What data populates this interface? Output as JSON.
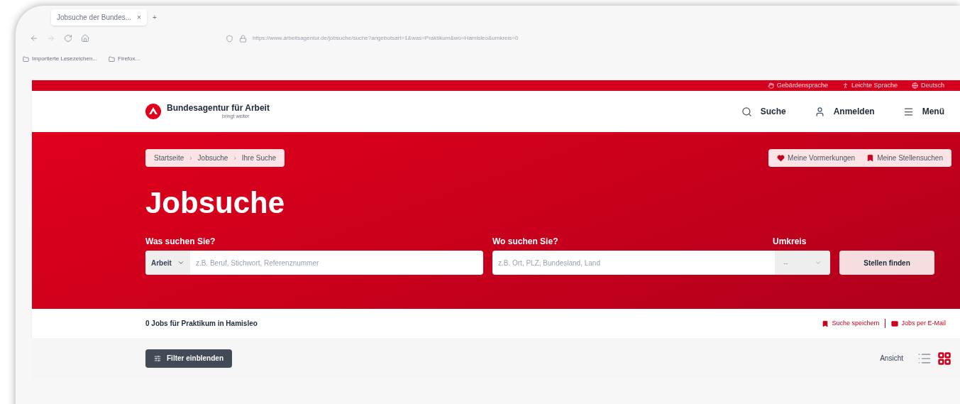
{
  "browser": {
    "tab_title": "Jobsuche der Bundes...",
    "tab_close": "×",
    "new_tab": "+",
    "url": "https://www.arbeitsagentur.de/jobsuche/suche?angebotsart=1&was=Praktikum&wo=Hamisleo&umkreis=0",
    "bookmarks": [
      "Importierte Lesezeichen...",
      "Firefox..."
    ]
  },
  "top_bar": {
    "links": [
      {
        "kind": "hand",
        "label": "Gebärdensprache"
      },
      {
        "kind": "person",
        "label": "Leichte Sprache"
      },
      {
        "kind": "globe",
        "label": "Deutsch"
      }
    ]
  },
  "header": {
    "logo_title": "Bundesagentur für Arbeit",
    "logo_subtitle": "bringt weiter",
    "nav": [
      {
        "kind": "search",
        "label": "Suche"
      },
      {
        "kind": "user",
        "label": "Anmelden"
      },
      {
        "kind": "menu",
        "label": "Menü"
      }
    ]
  },
  "hero": {
    "breadcrumb": [
      "Startseite",
      "Jobsuche",
      "Ihre Suche"
    ],
    "breadcrumb_separator": "›",
    "quick_links": [
      {
        "kind": "heart",
        "label": "Meine Vormerkungen"
      },
      {
        "kind": "bookmark",
        "label": "Meine Stellensuchen"
      }
    ],
    "title": "Jobsuche",
    "what": {
      "label": "Was suchen Sie?",
      "type_value": "Arbeit",
      "placeholder": "z.B. Beruf, Stichwort, Referenznummer"
    },
    "where": {
      "label": "Wo suchen Sie?",
      "placeholder": "z.B. Ort, PLZ, Bundesland, Land"
    },
    "radius": {
      "label": "Umkreis",
      "value": "--"
    },
    "submit": "Stellen finden"
  },
  "results": {
    "summary": "0 Jobs für Praktikum in Hamisleo",
    "actions": [
      {
        "kind": "bookmark",
        "label": "Suche speichern"
      },
      {
        "kind": "mail",
        "label": "Jobs per E-Mail"
      }
    ]
  },
  "toolbar": {
    "filter_button": "Filter einblenden",
    "view_label": "Ansicht",
    "views": [
      {
        "kind": "list",
        "selected": false
      },
      {
        "kind": "grid",
        "selected": true
      }
    ]
  }
}
